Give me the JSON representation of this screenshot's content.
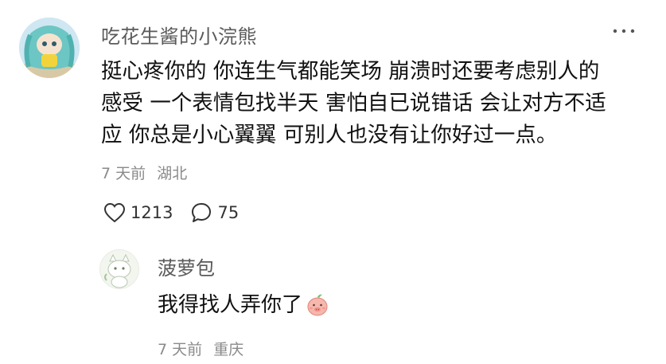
{
  "comment": {
    "username": "吃花生酱的小浣熊",
    "text": "挺心疼你的 你连生气都能笑场 崩溃时还要考虑别人的\n感受 一个表情包找半天 害怕自已说错话 会让对方不适\n应 你总是小心翼翼 可别人也没有让你好过一点。",
    "time": "7 天前",
    "location": "湖北",
    "likes": "1213",
    "replies": "75"
  },
  "reply": {
    "username": "菠萝包",
    "text": "我得找人弄你了",
    "time": "7 天前",
    "location": "重庆"
  },
  "icons": {
    "more": "more-dots-icon",
    "like": "heart-icon",
    "comment": "speech-bubble-icon",
    "emoji": "pig-face-emoji-icon"
  },
  "colors": {
    "username": "#5a5a5a",
    "meta": "#8a8a8a",
    "text": "#111111"
  }
}
